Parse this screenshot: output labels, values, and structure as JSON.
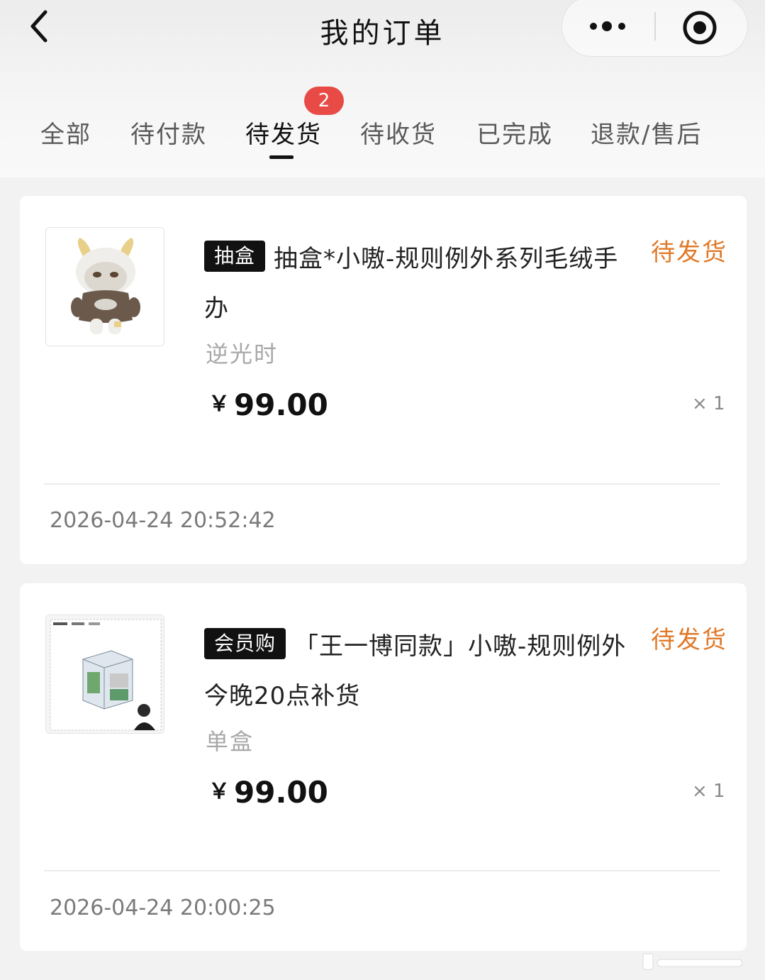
{
  "header": {
    "title": "我的订单",
    "back_icon": "chevron-left-icon",
    "more_icon": "more-dots-icon",
    "target_icon": "target-icon"
  },
  "tabs": [
    {
      "label": "全部",
      "active": false
    },
    {
      "label": "待付款",
      "active": false
    },
    {
      "label": "待发货",
      "active": true,
      "badge": "2"
    },
    {
      "label": "待收货",
      "active": false
    },
    {
      "label": "已完成",
      "active": false
    },
    {
      "label": "退款/售后",
      "active": false
    }
  ],
  "orders": [
    {
      "tag": "抽盒",
      "title": "抽盒*小嗷-规则例外系列毛绒手办",
      "status": "待发货",
      "spec": "逆光时",
      "currency": "￥",
      "price": "99.00",
      "qty": "× 1",
      "time": "2026-04-24  20:52:42",
      "thumb_icon": "plush-figure-image"
    },
    {
      "tag": "会员购",
      "title": "「王一博同款」小嗷-规则例外今晚20点补货",
      "status": "待发货",
      "spec": "单盒",
      "currency": "￥",
      "price": "99.00",
      "qty": "× 1",
      "time": "2026-04-24  20:00:25",
      "thumb_icon": "blind-box-image"
    }
  ],
  "colors": {
    "status": "#e07a2a",
    "badge": "#e84a45",
    "tag_bg": "#111111",
    "page_bg": "#f2f2f2"
  }
}
